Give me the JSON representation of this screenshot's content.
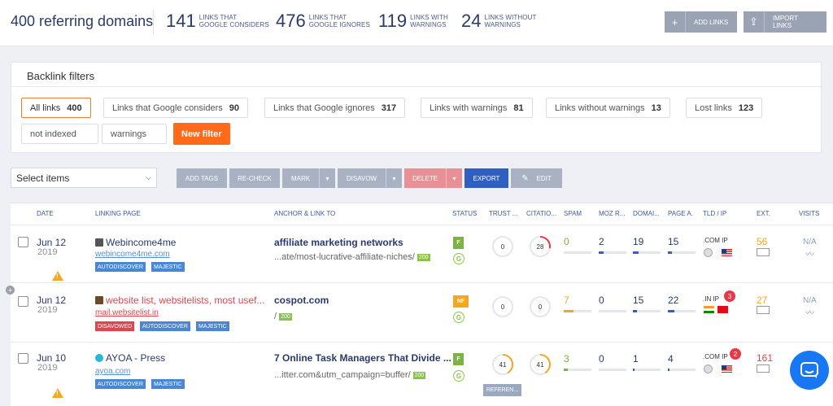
{
  "header": {
    "referring_domains": "400 referring domains",
    "stats": [
      {
        "num": "141",
        "label1": "LINKS THAT",
        "label2": "GOOGLE CONSIDERS"
      },
      {
        "num": "476",
        "label1": "LINKS THAT",
        "label2": "GOOGLE IGNORES"
      },
      {
        "num": "119",
        "label1": "LINKS WITH",
        "label2": "WARNINGS"
      },
      {
        "num": "24",
        "label1": "LINKS WITHOUT",
        "label2": "WARNINGS"
      }
    ],
    "add_links": "ADD LINKS",
    "import_links": "IMPORT LINKS"
  },
  "filters": {
    "title": "Backlink filters",
    "chips": [
      {
        "label": "All links",
        "count": "400"
      },
      {
        "label": "Links that Google considers",
        "count": "90"
      },
      {
        "label": "Links that Google ignores",
        "count": "317"
      },
      {
        "label": "Links with warnings",
        "count": "81"
      },
      {
        "label": "Links without warnings",
        "count": "13"
      },
      {
        "label": "Lost links",
        "count": "123"
      }
    ],
    "chips2": [
      "not indexed",
      "warnings"
    ],
    "new_filter": "New filter"
  },
  "toolbar": {
    "select_items": "Select items",
    "add_tags": "ADD TAGS",
    "recheck": "RE-CHECK",
    "mark": "MARK",
    "disavow": "DISAVOW",
    "delete": "DELETE",
    "export": "EXPORT",
    "edit": "EDIT"
  },
  "columns": {
    "date": "DATE",
    "linking_page": "LINKING PAGE",
    "anchor": "ANCHOR & LINK TO",
    "status": "STATUS",
    "trust": "TRUST ...",
    "citation": "CITATIO...",
    "spam": "SPAM",
    "moz": "MOZ R...",
    "domain": "DOMAI...",
    "page": "PAGE A.",
    "tld": "TLD / IP",
    "ext": "EXT.",
    "visits": "VISITS"
  },
  "rows": [
    {
      "date": "Jun 12",
      "year": "2019",
      "title": "Webincome4me",
      "url": "webincome4me.com",
      "tags": [
        "AUTODISCOVER",
        "MAJESTIC"
      ],
      "anchor": "affiliate marketing networks",
      "link": "...ate/most-lucrative-affiliate-niches/",
      "code": "200",
      "status": "F",
      "g": "G",
      "trust": "0",
      "citation": "28",
      "spam": "0",
      "moz": "2",
      "domain": "19",
      "page": "15",
      "tld": ".COM IP",
      "ext": "56",
      "visits": "N/A"
    },
    {
      "date": "Jun 12",
      "year": "2019",
      "title": "website list, websitelists, most usef...",
      "url": "mail.websitelist.in",
      "tags": [
        "DISAVOWED",
        "AUTODISCOVER",
        "MAJESTIC"
      ],
      "anchor": "cospot.com",
      "link": "/",
      "code": "200",
      "status": "NF",
      "g": "G",
      "trust": "0",
      "citation": "0",
      "spam": "7",
      "moz": "0",
      "domain": "15",
      "page": "22",
      "tld": ".IN IP",
      "ip_badge": "3",
      "ext": "27",
      "visits": "N/A"
    },
    {
      "date": "Jun 10",
      "year": "2019",
      "title": "AYOA - Press",
      "url": "ayoa.com",
      "tags": [
        "AUTODISCOVER",
        "MAJESTIC"
      ],
      "anchor": "7 Online Task Managers That Divide ...",
      "link": "...itter.com&utm_campaign=buffer/",
      "code": "200",
      "status": "F",
      "g": "G",
      "trust": "41",
      "citation": "41",
      "spam": "3",
      "moz": "0",
      "domain": "1",
      "page": "4",
      "tld": ".COM IP",
      "ip_badge": "2",
      "ext": "161",
      "referen": "REFEREN..."
    }
  ],
  "colors": {
    "accent": "#ff6a1a",
    "navy": "#2b3a6b",
    "export": "#2f5fc2",
    "delete": "#e98f96",
    "tag": "#4a86d4",
    "disavowed": "#e0454f"
  }
}
